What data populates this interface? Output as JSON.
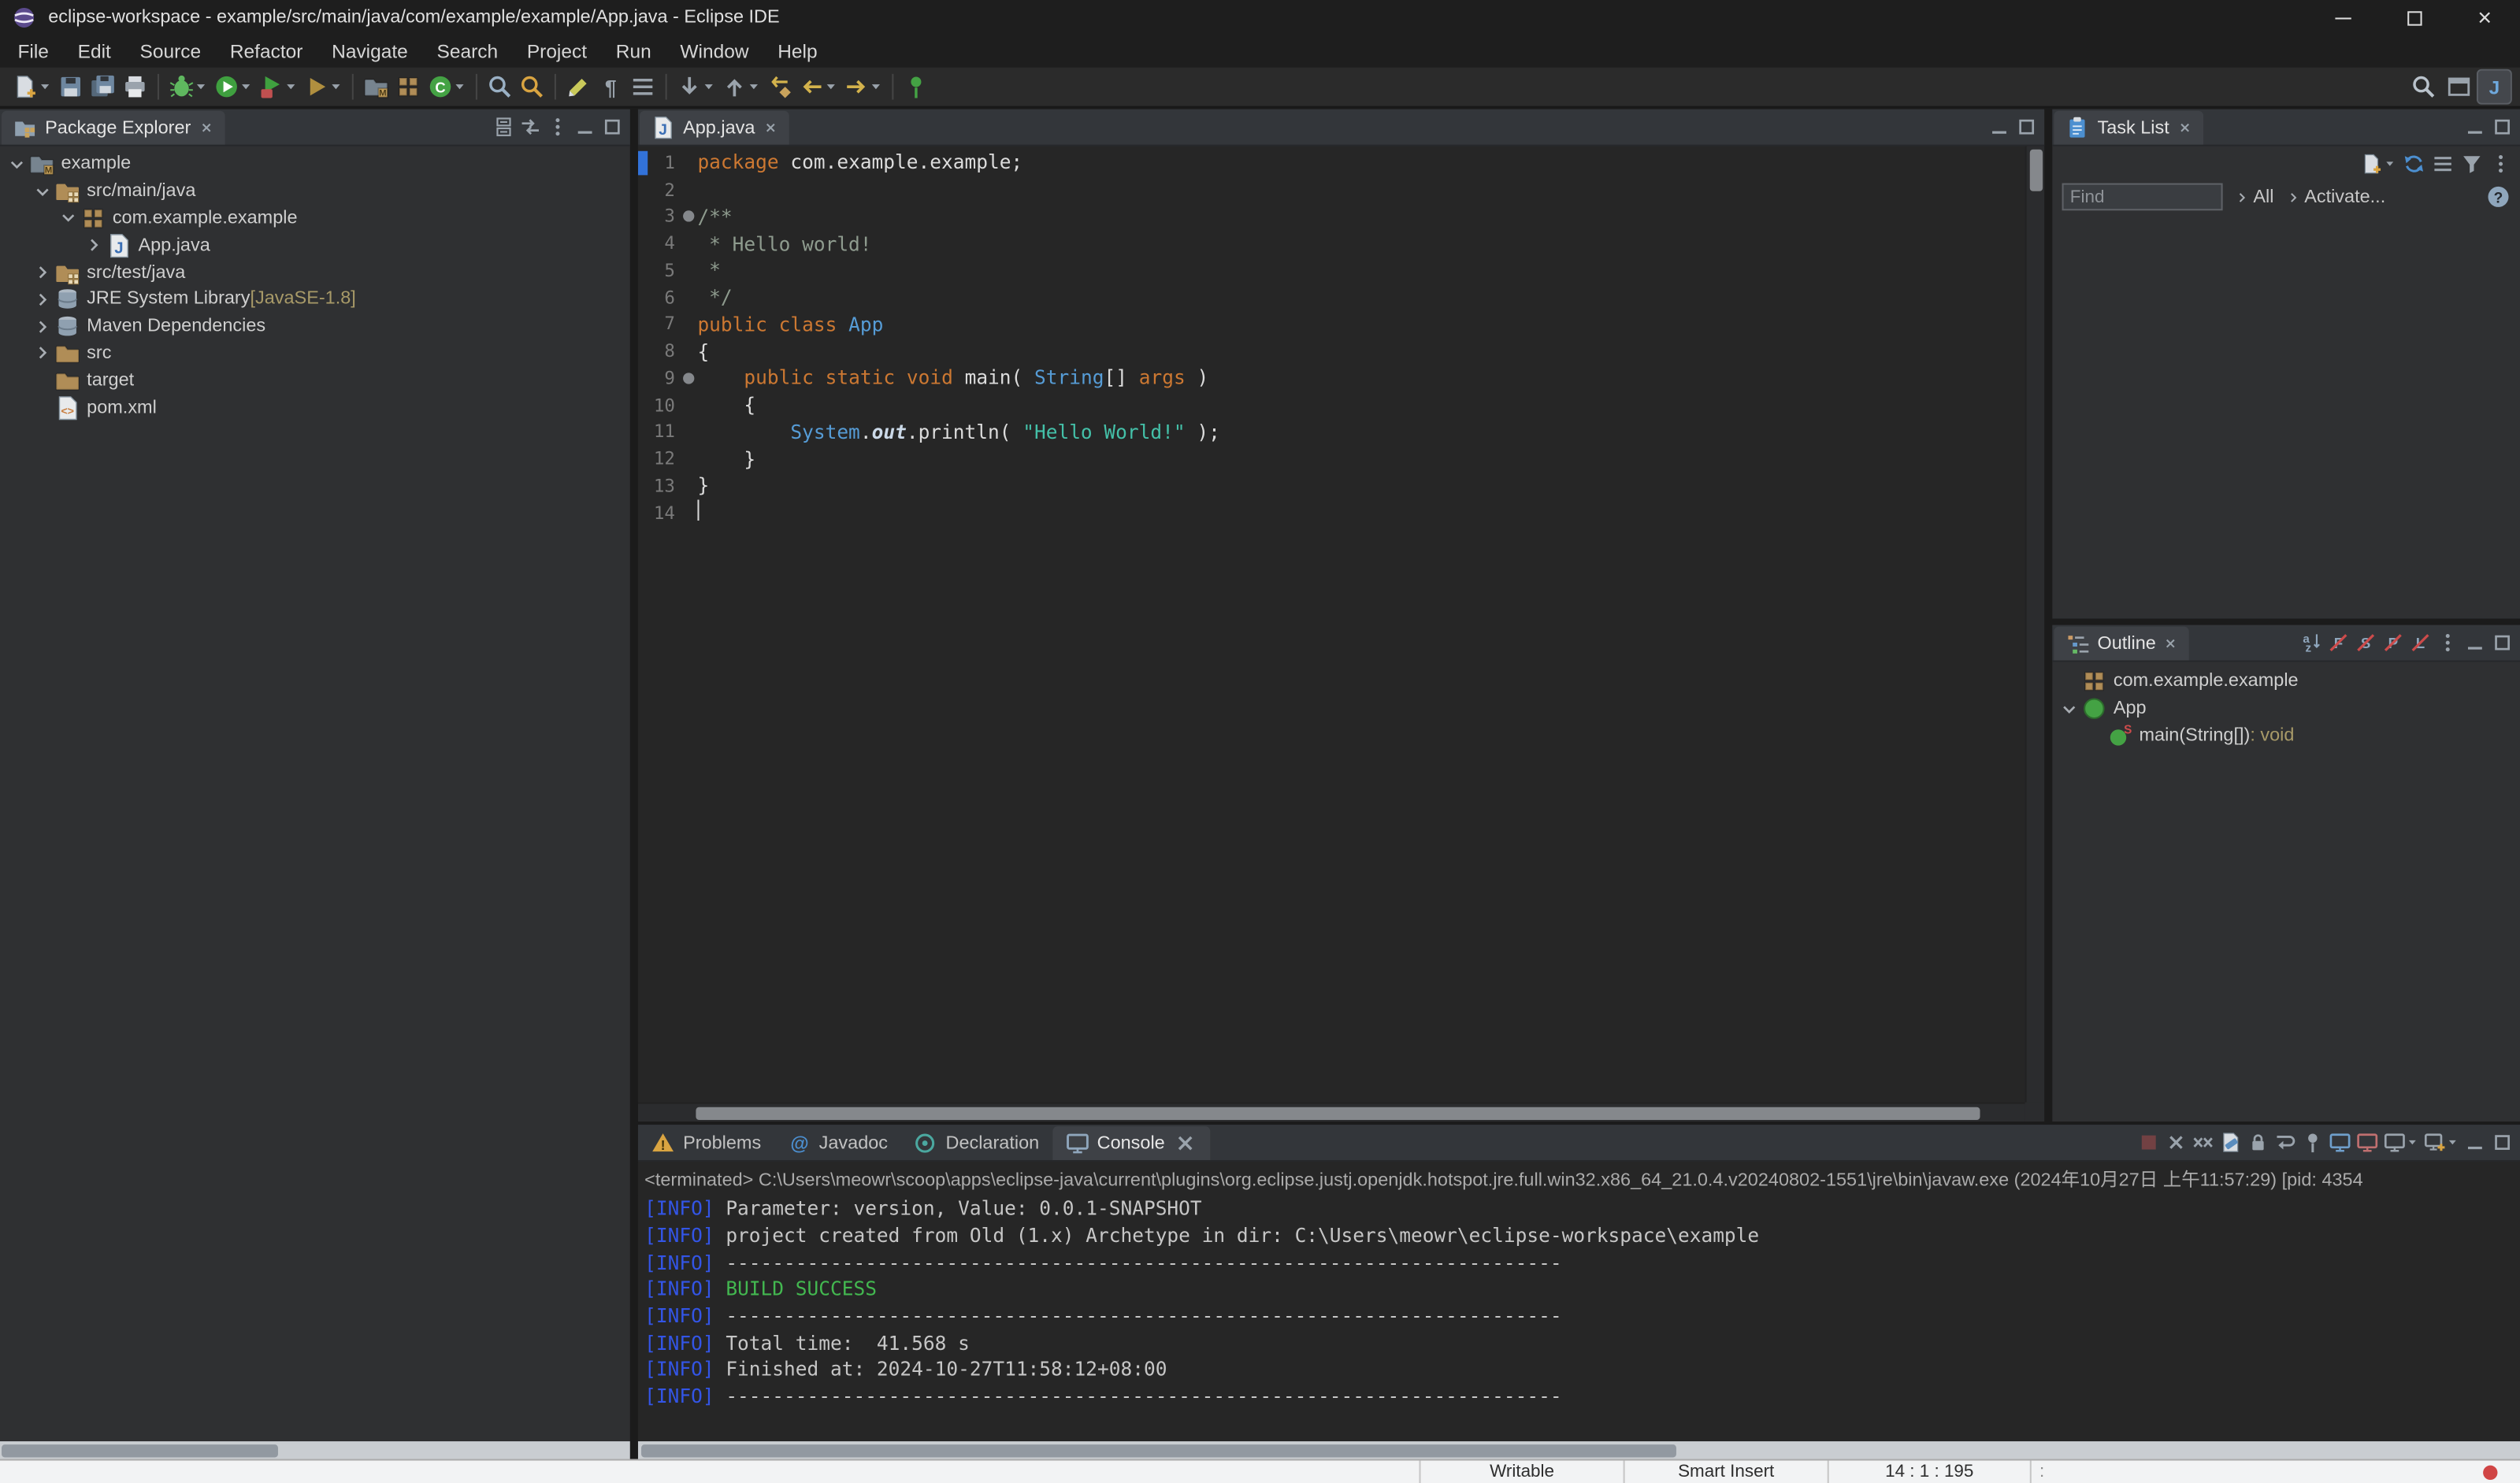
{
  "window": {
    "title": "eclipse-workspace - example/src/main/java/com/example/example/App.java - Eclipse IDE"
  },
  "menu": [
    "File",
    "Edit",
    "Source",
    "Refactor",
    "Navigate",
    "Search",
    "Project",
    "Run",
    "Window",
    "Help"
  ],
  "colors": {
    "kw": "#CC7832",
    "ty": "#569CD6",
    "str": "#44C0A8",
    "cm": "#8E9B8E",
    "pl": "#DCDCDC",
    "ln": "#7A7A7A",
    "info": "#3355E6",
    "ok": "#43B850",
    "ctext": "#C6C6C6",
    "deco": "#A89A68",
    "marker": "#3272D9",
    "dot": "#D04545"
  },
  "toolbar": {
    "groups": [
      [
        {
          "name": "new-wizard",
          "t": "new-doc",
          "dd": true
        },
        {
          "name": "save",
          "t": "floppy",
          "c": "#6E87A0"
        },
        {
          "name": "save-all",
          "t": "floppy-all",
          "c": "#6E87A0"
        },
        {
          "name": "print",
          "t": "printer",
          "c": "#9AA3AC"
        }
      ],
      [
        {
          "name": "debug",
          "t": "bug",
          "c": "#5FB75F",
          "dd": true
        },
        {
          "name": "run",
          "t": "play-circle",
          "c": "#3FA03F",
          "dd": true
        },
        {
          "name": "run-external-tools",
          "t": "play-box",
          "c": "#3FA03F",
          "dd": true
        },
        {
          "name": "coverage",
          "t": "play",
          "c": "#B08F3F",
          "dd": true
        }
      ],
      [
        {
          "name": "new-java-project",
          "t": "project"
        },
        {
          "name": "new-package",
          "t": "grid",
          "c": "#B08D57"
        },
        {
          "name": "new-class",
          "t": "circle",
          "c": "#44A244",
          "l": "C",
          "dd": true
        }
      ],
      [
        {
          "name": "open-type",
          "t": "mag",
          "c": "#9AB0C4"
        },
        {
          "name": "search",
          "t": "mag",
          "c": "#D9A441"
        }
      ],
      [
        {
          "name": "toggle-mark-occurrences",
          "t": "marker",
          "c": "#C9C95A"
        },
        {
          "name": "show-whitespace",
          "t": "para",
          "c": "#9AA3AC"
        },
        {
          "name": "block-selection",
          "t": "bars",
          "c": "#9AA3AC"
        }
      ],
      [
        {
          "name": "next-annotation",
          "t": "arrow-down",
          "c": "#9AA3AC",
          "dd": true
        },
        {
          "name": "previous-annotation",
          "t": "arrow-up",
          "c": "#9AA3AC",
          "dd": true
        },
        {
          "name": "last-edit-location",
          "t": "arrow-edit",
          "c": "#D3B24C"
        },
        {
          "name": "back",
          "t": "arrow-left",
          "c": "#D3B24C",
          "dd": true
        },
        {
          "name": "forward",
          "t": "arrow-right",
          "c": "#D3B24C",
          "dd": true
        }
      ],
      [
        {
          "name": "pin-editor",
          "t": "pin",
          "c": "#44A244"
        }
      ]
    ],
    "right": [
      {
        "name": "quick-search",
        "t": "mag",
        "c": "#B9C2CB"
      },
      {
        "name": "open-perspective",
        "t": "perspective",
        "c": "#9AA3AC"
      },
      {
        "name": "java-perspective",
        "t": "letter",
        "l": "J",
        "c": "#6FA8DC",
        "active": true
      }
    ]
  },
  "package_explorer": {
    "title": "Package Explorer",
    "header_icons": [
      {
        "name": "collapse-all",
        "t": "collapse-all",
        "c": "#9AA3AC"
      },
      {
        "name": "link-with-editor",
        "t": "link",
        "c": "#9AA3AC"
      },
      {
        "name": "view-menu",
        "t": "dots",
        "c": "#9AA3AC"
      },
      {
        "name": "minimize",
        "t": "min",
        "c": "#9AA3AC"
      },
      {
        "name": "maximize",
        "t": "max",
        "c": "#9AA3AC"
      }
    ],
    "items": [
      {
        "label": "example",
        "level": 0,
        "arrow": "open",
        "icon": "project"
      },
      {
        "label": "src/main/java",
        "level": 1,
        "arrow": "open",
        "icon": "src-folder"
      },
      {
        "label": "com.example.example",
        "level": 2,
        "arrow": "open",
        "icon": "package"
      },
      {
        "label": "App.java",
        "level": 3,
        "arrow": "closed",
        "icon": "java-file"
      },
      {
        "label": "src/test/java",
        "level": 1,
        "arrow": "closed",
        "icon": "src-folder"
      },
      {
        "label": "JRE System Library",
        "suffix": " [JavaSE-1.8]",
        "level": 1,
        "arrow": "closed",
        "icon": "library"
      },
      {
        "label": "Maven Dependencies",
        "level": 1,
        "arrow": "closed",
        "icon": "library"
      },
      {
        "label": "src",
        "level": 1,
        "arrow": "closed",
        "icon": "folder"
      },
      {
        "label": "target",
        "level": 1,
        "arrow": "none",
        "icon": "folder"
      },
      {
        "label": "pom.xml",
        "level": 1,
        "arrow": "none",
        "icon": "xml-file"
      }
    ]
  },
  "editor": {
    "tab": "App.java",
    "header_icons": [
      {
        "name": "minimize",
        "t": "min",
        "c": "#9AA3AC"
      },
      {
        "name": "maximize",
        "t": "max",
        "c": "#9AA3AC"
      }
    ],
    "lines": [
      {
        "n": "1",
        "marker": true,
        "tokens": [
          [
            "k",
            "package"
          ],
          [
            "p",
            " com.example.example;"
          ]
        ]
      },
      {
        "n": "2",
        "tokens": []
      },
      {
        "n": "3",
        "fold": true,
        "tokens": [
          [
            "c",
            "/**"
          ]
        ]
      },
      {
        "n": "4",
        "tokens": [
          [
            "c",
            " * Hello world!"
          ]
        ]
      },
      {
        "n": "5",
        "tokens": [
          [
            "c",
            " *"
          ]
        ]
      },
      {
        "n": "6",
        "tokens": [
          [
            "c",
            " */"
          ]
        ]
      },
      {
        "n": "7",
        "tokens": [
          [
            "k",
            "public"
          ],
          [
            "p",
            " "
          ],
          [
            "k",
            "class"
          ],
          [
            "p",
            " "
          ],
          [
            "t",
            "App"
          ]
        ]
      },
      {
        "n": "8",
        "tokens": [
          [
            "p",
            "{"
          ]
        ]
      },
      {
        "n": "9",
        "fold": true,
        "tokens": [
          [
            "p",
            "    "
          ],
          [
            "k",
            "public"
          ],
          [
            "p",
            " "
          ],
          [
            "k",
            "static"
          ],
          [
            "p",
            " "
          ],
          [
            "k",
            "void"
          ],
          [
            "p",
            " main( "
          ],
          [
            "t",
            "String"
          ],
          [
            "p",
            "[] "
          ],
          [
            "v",
            "args"
          ],
          [
            "p",
            " )"
          ]
        ]
      },
      {
        "n": "10",
        "tokens": [
          [
            "p",
            "    {"
          ]
        ]
      },
      {
        "n": "11",
        "tokens": [
          [
            "p",
            "        "
          ],
          [
            "t",
            "System"
          ],
          [
            "p",
            "."
          ],
          [
            "f",
            "out"
          ],
          [
            "p",
            ".println( "
          ],
          [
            "s",
            "\"Hello World!\""
          ],
          [
            "p",
            " );"
          ]
        ]
      },
      {
        "n": "12",
        "tokens": [
          [
            "p",
            "    }"
          ]
        ]
      },
      {
        "n": "13",
        "tokens": [
          [
            "p",
            "}"
          ]
        ]
      },
      {
        "n": "14",
        "cursor": true,
        "tokens": []
      }
    ]
  },
  "task_list": {
    "title": "Task List",
    "header_icons": [
      {
        "name": "minimize",
        "t": "min",
        "c": "#9AA3AC"
      },
      {
        "name": "maximize",
        "t": "max",
        "c": "#9AA3AC"
      }
    ],
    "toolbar": [
      {
        "name": "new-task",
        "t": "new-doc",
        "dd": true
      },
      {
        "name": "synchronize",
        "t": "sync",
        "c": "#4C8FD0"
      },
      {
        "name": "categorized",
        "t": "bars",
        "c": "#9AA3AC"
      },
      {
        "name": "filter-completed",
        "t": "funnel",
        "c": "#9AA3AC"
      },
      {
        "name": "view-menu",
        "t": "dots",
        "c": "#9AA3AC"
      }
    ],
    "find_placeholder": "Find",
    "scope_all": "All",
    "activate_label": "Activate...",
    "help": "?"
  },
  "outline": {
    "title": "Outline",
    "header_icons": [
      {
        "name": "sort",
        "t": "sort-az",
        "c": "#8FA6BC"
      },
      {
        "name": "hide-fields",
        "t": "slash-letter",
        "l": "F",
        "c": "#8FA6BC"
      },
      {
        "name": "hide-static-members",
        "t": "slash-letter",
        "l": "S",
        "c": "#8FA6BC"
      },
      {
        "name": "hide-non-public",
        "t": "slash-letter",
        "l": "P",
        "c": "#8FA6BC"
      },
      {
        "name": "hide-local-types",
        "t": "slash-letter",
        "l": "L",
        "c": "#8FA6BC"
      },
      {
        "name": "view-menu",
        "t": "dots",
        "c": "#9AA3AC"
      },
      {
        "name": "minimize",
        "t": "min",
        "c": "#9AA3AC"
      },
      {
        "name": "maximize",
        "t": "max",
        "c": "#9AA3AC"
      }
    ],
    "items": [
      {
        "label": "com.example.example",
        "level": 0,
        "arrow": "none",
        "icon": "package"
      },
      {
        "label": "App",
        "level": 0,
        "arrow": "open",
        "icon": "class"
      },
      {
        "label": "main(String[])",
        "suffix": " : void",
        "level": 1,
        "arrow": "none",
        "icon": "method-static"
      }
    ]
  },
  "bottom": {
    "tabs": [
      {
        "label": "Problems",
        "icon": {
          "t": "problems"
        }
      },
      {
        "label": "Javadoc",
        "icon": {
          "t": "at",
          "c": "#4C8FD0"
        }
      },
      {
        "label": "Declaration",
        "icon": {
          "t": "declaration"
        }
      },
      {
        "label": "Console",
        "icon": {
          "t": "monitor",
          "c": "#8FA6BC"
        },
        "active": true,
        "closable": true
      }
    ],
    "toolbar": [
      {
        "name": "terminate",
        "t": "square",
        "c": "#C05050",
        "dim": true
      },
      {
        "name": "remove-launch",
        "t": "x",
        "c": "#9AA3AC"
      },
      {
        "name": "remove-all-terminated",
        "t": "xx",
        "c": "#9AA3AC"
      },
      {
        "name": "clear-console",
        "t": "clear"
      },
      {
        "name": "scroll-lock",
        "t": "lock",
        "c": "#9AA3AC"
      },
      {
        "name": "word-wrap",
        "t": "wrap",
        "c": "#9AA3AC"
      },
      {
        "name": "pin-console",
        "t": "pin",
        "c": "#9AA3AC"
      },
      {
        "name": "show-on-stdout",
        "t": "monitor",
        "c": "#6F9FCB"
      },
      {
        "name": "show-on-stderr",
        "t": "monitor",
        "c": "#C07070"
      },
      {
        "name": "display-selected-console",
        "t": "monitor",
        "c": "#9AA3AC",
        "dd": true
      },
      {
        "name": "open-console",
        "t": "monitor-plus",
        "c": "#9AA3AC",
        "dd": true
      },
      {
        "name": "minimize",
        "t": "min",
        "c": "#9AA3AC"
      },
      {
        "name": "maximize",
        "t": "max",
        "c": "#9AA3AC"
      }
    ],
    "console_label": "<terminated> C:\\Users\\meowr\\scoop\\apps\\eclipse-java\\current\\plugins\\org.eclipse.justj.openjdk.hotspot.jre.full.win32.x86_64_21.0.4.v20240802-1551\\jre\\bin\\javaw.exe (2024年10月27日 上午11:57:29) [pid: 4354",
    "lines": [
      {
        "parts": [
          [
            "info",
            "[INFO]"
          ],
          [
            "p",
            " Parameter: version, Value: 0.0.1-SNAPSHOT"
          ]
        ]
      },
      {
        "parts": [
          [
            "info",
            "[INFO]"
          ],
          [
            "p",
            " project created from Old (1.x) Archetype in dir: C:\\Users\\meowr\\eclipse-workspace\\example"
          ]
        ]
      },
      {
        "parts": [
          [
            "info",
            "[INFO]"
          ],
          [
            "p",
            " ------------------------------------------------------------------------"
          ]
        ]
      },
      {
        "parts": [
          [
            "info",
            "[INFO]"
          ],
          [
            "p",
            " "
          ],
          [
            "ok",
            "BUILD SUCCESS"
          ]
        ]
      },
      {
        "parts": [
          [
            "info",
            "[INFO]"
          ],
          [
            "p",
            " ------------------------------------------------------------------------"
          ]
        ]
      },
      {
        "parts": [
          [
            "info",
            "[INFO]"
          ],
          [
            "p",
            " Total time:  41.568 s"
          ]
        ]
      },
      {
        "parts": [
          [
            "info",
            "[INFO]"
          ],
          [
            "p",
            " Finished at: 2024-10-27T11:58:12+08:00"
          ]
        ]
      },
      {
        "parts": [
          [
            "info",
            "[INFO]"
          ],
          [
            "p",
            " ------------------------------------------------------------------------"
          ]
        ]
      }
    ]
  },
  "status_bar": {
    "writable": "Writable",
    "smart_insert": "Smart Insert",
    "position": "14 : 1 : 195",
    "colon_mark": ":"
  }
}
